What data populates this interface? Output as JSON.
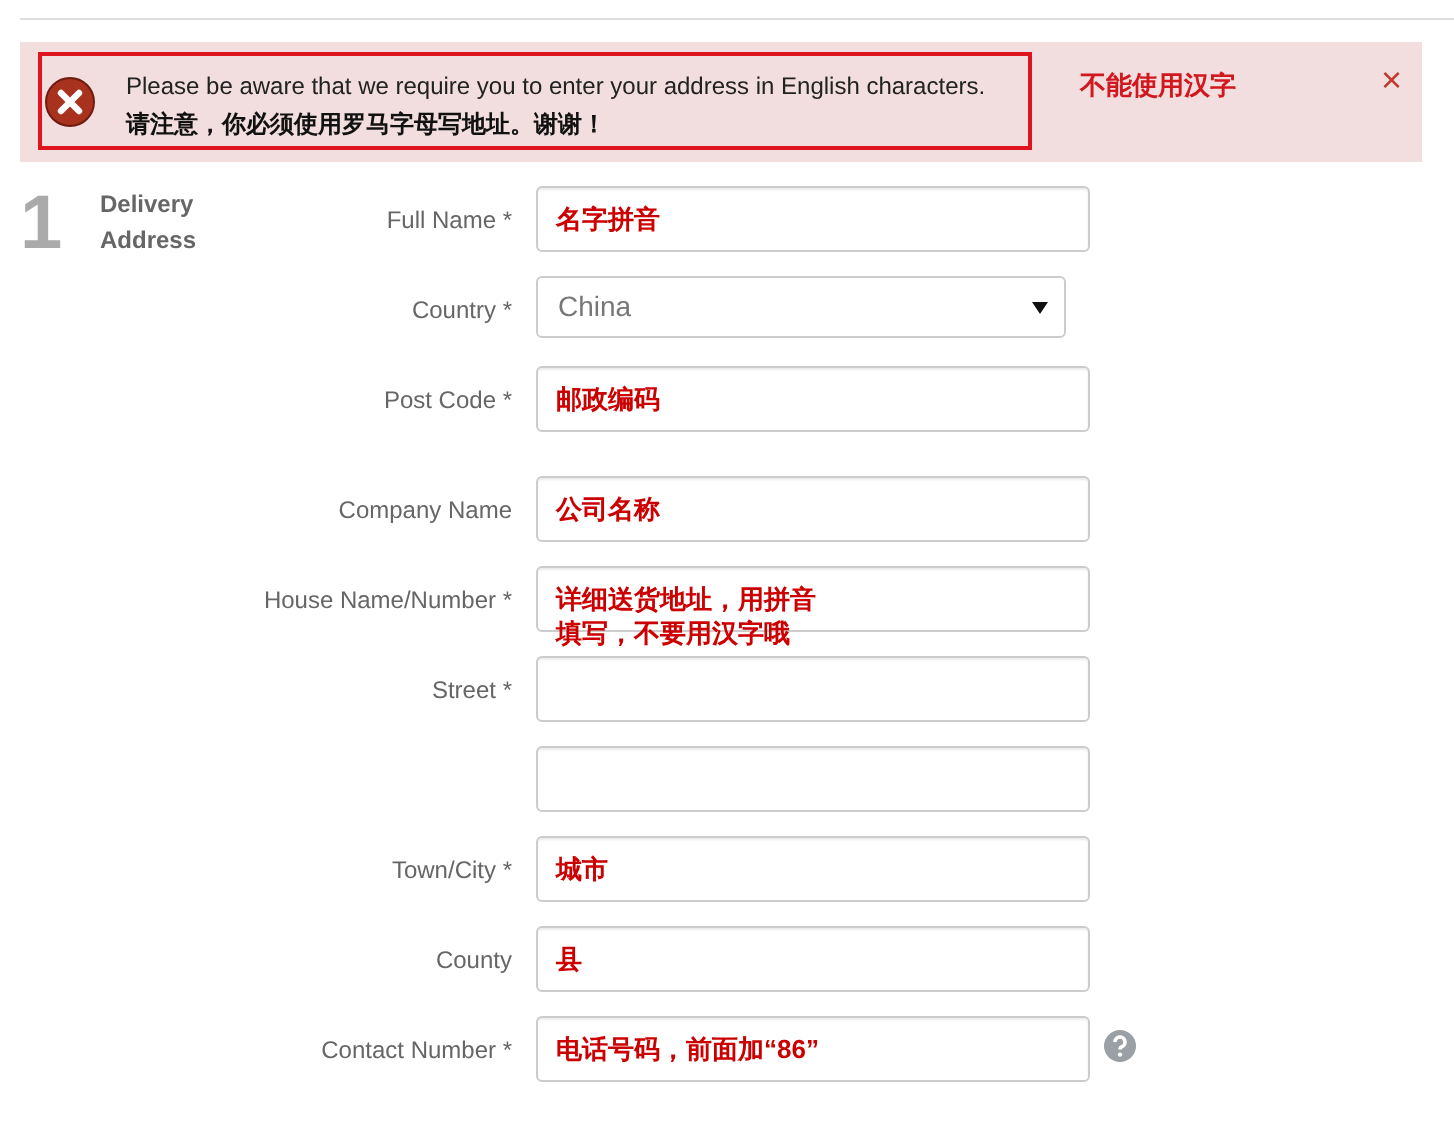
{
  "alert": {
    "message": "Please be aware that we require you to enter your address in English characters.",
    "message_translation": "请注意，你必须使用罗马字母写地址。谢谢！",
    "annotation": "不能使用汉字",
    "close": "×"
  },
  "section": {
    "step": "1",
    "title": "Delivery Address"
  },
  "field_groups": [
    [
      {
        "kind": "text",
        "label": "Full Name *",
        "annotation": "名字拼音"
      },
      {
        "kind": "select",
        "label": "Country *",
        "value": "China"
      },
      {
        "kind": "text",
        "label": "Post Code *",
        "annotation": "邮政编码"
      }
    ],
    [
      {
        "kind": "text",
        "label": "Company Name",
        "annotation": "公司名称"
      },
      {
        "kind": "text",
        "label": "House Name/Number *",
        "annotation": "详细送货地址，用拼音填写，不要用汉字哦"
      },
      {
        "kind": "text",
        "label": "Street *"
      },
      {
        "kind": "text"
      },
      {
        "kind": "text",
        "label": "Town/City *",
        "annotation": "城市"
      },
      {
        "kind": "text",
        "label": "County",
        "annotation": "县"
      },
      {
        "kind": "text",
        "label": "Contact Number *",
        "annotation": "电话号码，前面加“86”",
        "help": true
      }
    ]
  ]
}
